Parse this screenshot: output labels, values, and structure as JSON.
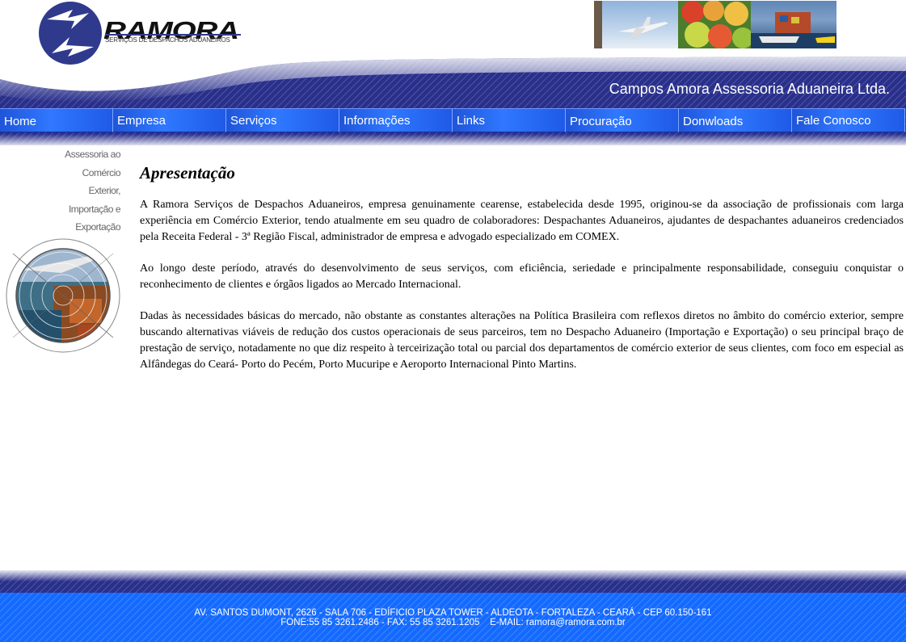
{
  "header": {
    "logo_text": "RAMORA",
    "logo_subtitle": "SERVIÇOS DE DESPACHOS ADUANEIROS",
    "company_name": "Campos Amora Assessoria Aduaneira Ltda."
  },
  "nav": {
    "items": [
      {
        "label": "Home"
      },
      {
        "label": "Empresa"
      },
      {
        "label": "Serviços"
      },
      {
        "label": "Informações"
      },
      {
        "label": "Links"
      },
      {
        "label": "Procuração"
      },
      {
        "label": "Donwloads"
      },
      {
        "label": "Fale Conosco"
      }
    ]
  },
  "sidebar": {
    "tagline": [
      "Assessoria ao",
      "Comércio",
      "Exterior,",
      "Importação e",
      "Exportação"
    ]
  },
  "main": {
    "title": "Apresentação",
    "paragraphs": [
      "A Ramora Serviços de Despachos Aduaneiros, empresa genuinamente cearense, estabelecida desde 1995, originou-se da associação de profissionais com larga experiência em Comércio Exterior, tendo atualmente em seu quadro de colaboradores: Despachantes Aduaneiros, ajudantes de despachantes aduaneiros credenciados pela Receita Federal - 3ª Região Fiscal, administrador de empresa e advogado especializado em COMEX.",
      "Ao longo deste período, através do desenvolvimento de seus serviços, com eficiência, seriedade e principalmente responsabilidade, conseguiu conquistar o reconhecimento de clientes e órgãos ligados ao Mercado Internacional.",
      "Dadas às necessidades básicas do mercado, não obstante as constantes alterações na Política Brasileira com reflexos diretos no âmbito do comércio exterior, sempre buscando alternativas viáveis de redução dos custos operacionais de seus parceiros, tem no Despacho Aduaneiro (Importação e Exportação) o seu principal braço de prestação de serviço, notadamente no que diz respeito à terceirização total ou parcial dos departamentos de comércio exterior de seus clientes, com foco em especial as Alfândegas do Ceará- Porto do Pecém, Porto Mucuripe e Aeroporto Internacional Pinto Martins."
    ]
  },
  "footer": {
    "address": "AV. SANTOS DUMONT, 2626 - SALA 706 - EDÍFICIO PLAZA TOWER - ALDEOTA - FORTALEZA - CEARÁ - CEP 60.150-161",
    "contact": "FONE:55 85 3261.2486 - FAX: 55 85 3261.1205    E-MAIL: ramora@ramora.com.br"
  },
  "colors": {
    "banner_dark": "#2a2f86",
    "nav_blue": "#2f78ff",
    "footer_blue": "#1a6dff",
    "logo_blue": "#303a8c"
  }
}
